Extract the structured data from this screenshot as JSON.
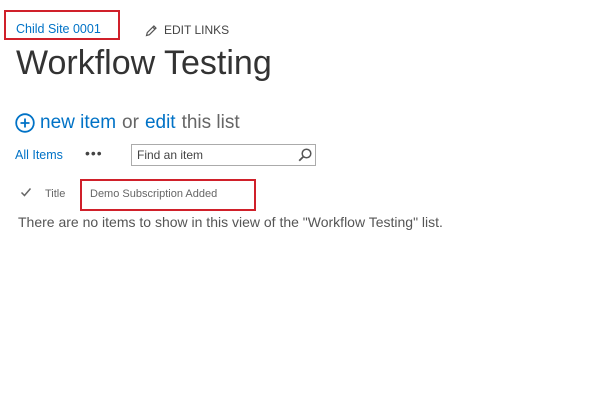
{
  "breadcrumb": {
    "site_link": "Child Site 0001"
  },
  "header": {
    "edit_links_label": "EDIT LINKS",
    "edit_links_icon": "pencil-icon",
    "page_title": "Workflow Testing"
  },
  "quick_actions": {
    "add_icon": "plus-circle-icon",
    "new_item": "new item",
    "or": "or",
    "edit": "edit",
    "this_list": "this list"
  },
  "toolbar": {
    "view_label": "All Items",
    "more_label": "•••",
    "search_placeholder": "Find an item",
    "search_icon": "search-icon"
  },
  "list": {
    "columns": [
      "Title",
      "Demo Subscription Added"
    ],
    "empty_message": "There are no items to show in this view of the \"Workflow Testing\" list."
  },
  "colors": {
    "link": "#0072c6",
    "highlight_box": "#d0202a",
    "text": "#444444"
  }
}
